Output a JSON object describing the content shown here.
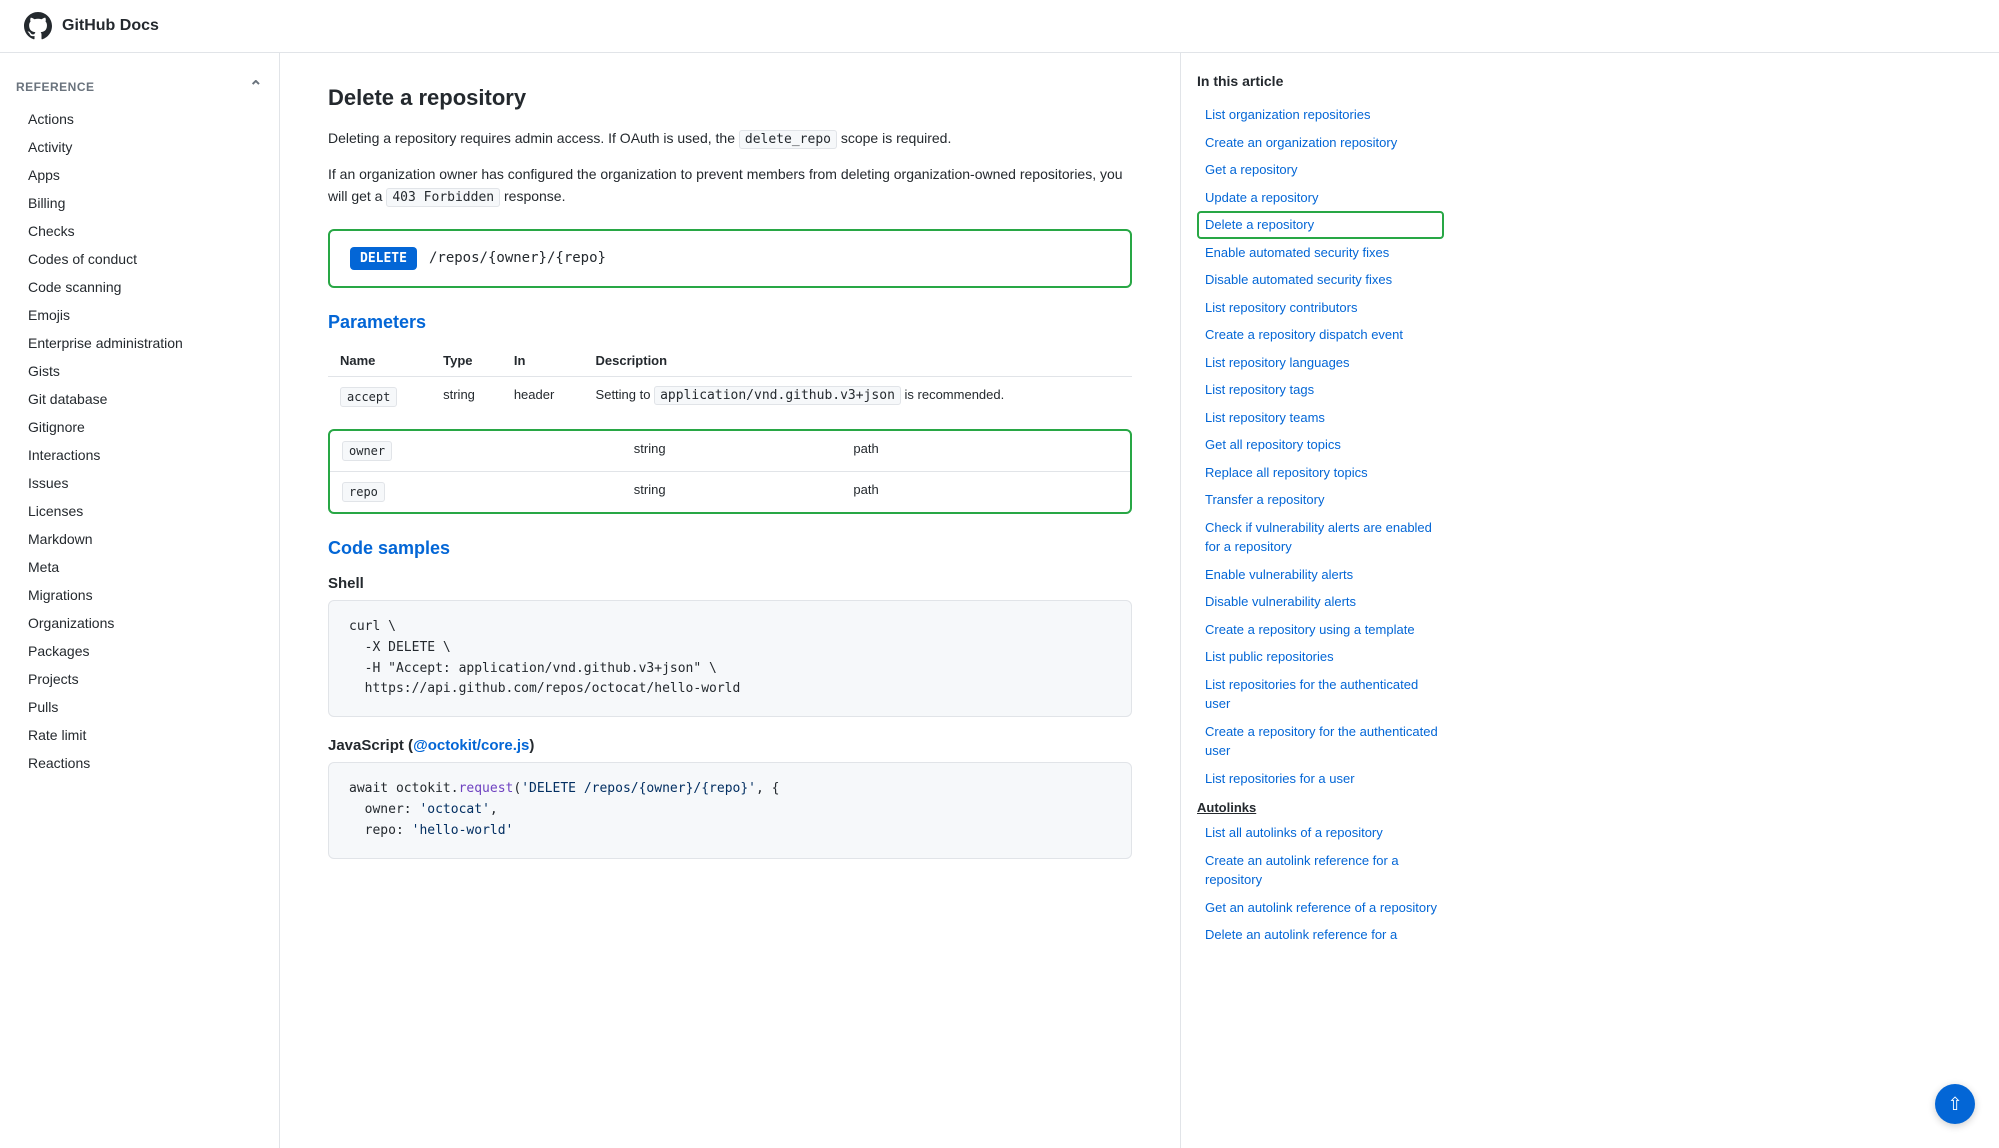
{
  "topbar": {
    "logo_alt": "GitHub",
    "title": "GitHub Docs"
  },
  "sidebar": {
    "section_label": "REFERENCE",
    "items": [
      {
        "label": "Actions",
        "active": false
      },
      {
        "label": "Activity",
        "active": false
      },
      {
        "label": "Apps",
        "active": false
      },
      {
        "label": "Billing",
        "active": false
      },
      {
        "label": "Checks",
        "active": false
      },
      {
        "label": "Codes of conduct",
        "active": false
      },
      {
        "label": "Code scanning",
        "active": false
      },
      {
        "label": "Emojis",
        "active": false
      },
      {
        "label": "Enterprise administration",
        "active": false
      },
      {
        "label": "Gists",
        "active": false
      },
      {
        "label": "Git database",
        "active": false
      },
      {
        "label": "Gitignore",
        "active": false
      },
      {
        "label": "Interactions",
        "active": false
      },
      {
        "label": "Issues",
        "active": false
      },
      {
        "label": "Licenses",
        "active": false
      },
      {
        "label": "Markdown",
        "active": false
      },
      {
        "label": "Meta",
        "active": false
      },
      {
        "label": "Migrations",
        "active": false
      },
      {
        "label": "Organizations",
        "active": false
      },
      {
        "label": "Packages",
        "active": false
      },
      {
        "label": "Projects",
        "active": false
      },
      {
        "label": "Pulls",
        "active": false
      },
      {
        "label": "Rate limit",
        "active": false
      },
      {
        "label": "Reactions",
        "active": false
      }
    ]
  },
  "main": {
    "page_title": "Delete a repository",
    "description1": "Deleting a repository requires admin access. If OAuth is used, the",
    "inline_code1": "delete_repo",
    "description1b": "scope is required.",
    "description2": "If an organization owner has configured the organization to prevent members from deleting organization-owned repositories, you will get a",
    "inline_code2": "403 Forbidden",
    "description2b": "response.",
    "method": "DELETE",
    "endpoint_path": "/repos/{owner}/{repo}",
    "params_section_label": "Parameters",
    "params_table": {
      "headers": [
        "Name",
        "Type",
        "In",
        "Description"
      ],
      "accept_row": {
        "name": "accept",
        "type": "string",
        "in": "header",
        "description_pre": "Setting to",
        "description_code": "application/vnd.github.v3+json",
        "description_post": "is recommended."
      },
      "highlighted_rows": [
        {
          "name": "owner",
          "type": "string",
          "in": "path",
          "description": ""
        },
        {
          "name": "repo",
          "type": "string",
          "in": "path",
          "description": ""
        }
      ]
    },
    "code_samples_label": "Code samples",
    "shell_label": "Shell",
    "shell_code": "curl \\\n  -X DELETE \\\n  -H \"Accept: application/vnd.github.v3+json\" \\\n  https://api.github.com/repos/octocat/hello-world",
    "js_label": "JavaScript",
    "js_link_text": "@octokit/core.js",
    "js_link_url": "#",
    "js_code_line1": "await octokit.request('DELETE /repos/{owner}/{repo}', {",
    "js_code_line2": "  owner: 'octocat',",
    "js_code_line3": "  repo: 'hello-world'"
  },
  "right_sidebar": {
    "title": "In this article",
    "items": [
      {
        "label": "List organization repositories",
        "active": false,
        "group": false
      },
      {
        "label": "Create an organization repository",
        "active": false,
        "group": false
      },
      {
        "label": "Get a repository",
        "active": false,
        "group": false
      },
      {
        "label": "Update a repository",
        "active": false,
        "group": false
      },
      {
        "label": "Delete a repository",
        "active": true,
        "group": false
      },
      {
        "label": "Enable automated security fixes",
        "active": false,
        "group": false
      },
      {
        "label": "Disable automated security fixes",
        "active": false,
        "group": false
      },
      {
        "label": "List repository contributors",
        "active": false,
        "group": false
      },
      {
        "label": "Create a repository dispatch event",
        "active": false,
        "group": false
      },
      {
        "label": "List repository languages",
        "active": false,
        "group": false
      },
      {
        "label": "List repository tags",
        "active": false,
        "group": false
      },
      {
        "label": "List repository teams",
        "active": false,
        "group": false
      },
      {
        "label": "Get all repository topics",
        "active": false,
        "group": false
      },
      {
        "label": "Replace all repository topics",
        "active": false,
        "group": false
      },
      {
        "label": "Transfer a repository",
        "active": false,
        "group": false
      },
      {
        "label": "Check if vulnerability alerts are enabled for a repository",
        "active": false,
        "group": false
      },
      {
        "label": "Enable vulnerability alerts",
        "active": false,
        "group": false
      },
      {
        "label": "Disable vulnerability alerts",
        "active": false,
        "group": false
      },
      {
        "label": "Create a repository using a template",
        "active": false,
        "group": false
      },
      {
        "label": "List public repositories",
        "active": false,
        "group": false
      },
      {
        "label": "List repositories for the authenticated user",
        "active": false,
        "group": false
      },
      {
        "label": "Create a repository for the authenticated user",
        "active": false,
        "group": false
      },
      {
        "label": "List repositories for a user",
        "active": false,
        "group": false
      },
      {
        "label": "Autolinks",
        "active": false,
        "group": true
      },
      {
        "label": "List all autolinks of a repository",
        "active": false,
        "group": false
      },
      {
        "label": "Create an autolink reference for a repository",
        "active": false,
        "group": false
      },
      {
        "label": "Get an autolink reference of a repository",
        "active": false,
        "group": false
      },
      {
        "label": "Delete an autolink reference for a",
        "active": false,
        "group": false
      }
    ]
  },
  "scroll_top": "▲"
}
